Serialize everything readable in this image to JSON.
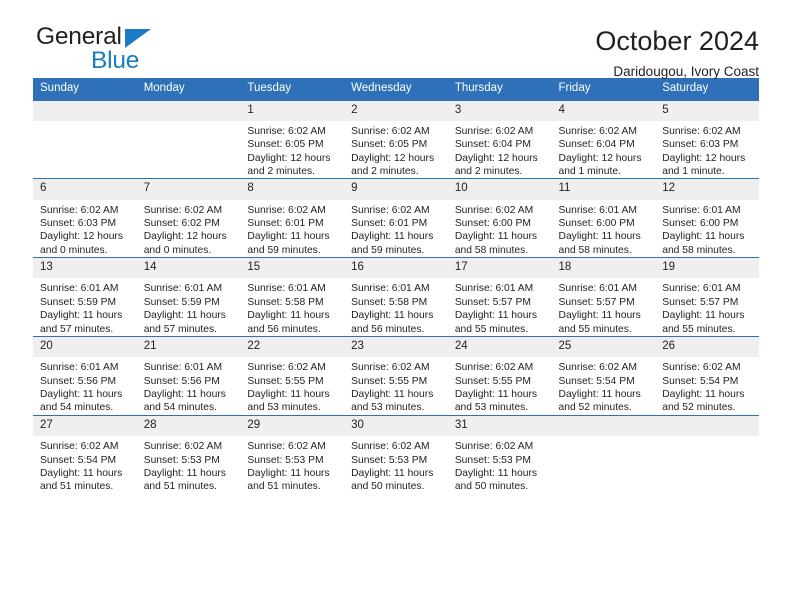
{
  "brand": {
    "name_top": "General",
    "name_bottom": "Blue",
    "triangle_color": "#1a7cc4",
    "text_color": "#231f20"
  },
  "header": {
    "month_title": "October 2024",
    "location": "Daridougou, Ivory Coast"
  },
  "theme": {
    "header_blue": "#2e71b8",
    "daynum_band": "#efefef",
    "text": "#231f20"
  },
  "weekdays": [
    "Sunday",
    "Monday",
    "Tuesday",
    "Wednesday",
    "Thursday",
    "Friday",
    "Saturday"
  ],
  "weeks": [
    [
      {
        "day": "",
        "blank": true
      },
      {
        "day": "",
        "blank": true
      },
      {
        "day": "1",
        "sunrise": "Sunrise: 6:02 AM",
        "sunset": "Sunset: 6:05 PM",
        "daylight": "Daylight: 12 hours and 2 minutes."
      },
      {
        "day": "2",
        "sunrise": "Sunrise: 6:02 AM",
        "sunset": "Sunset: 6:05 PM",
        "daylight": "Daylight: 12 hours and 2 minutes."
      },
      {
        "day": "3",
        "sunrise": "Sunrise: 6:02 AM",
        "sunset": "Sunset: 6:04 PM",
        "daylight": "Daylight: 12 hours and 2 minutes."
      },
      {
        "day": "4",
        "sunrise": "Sunrise: 6:02 AM",
        "sunset": "Sunset: 6:04 PM",
        "daylight": "Daylight: 12 hours and 1 minute."
      },
      {
        "day": "5",
        "sunrise": "Sunrise: 6:02 AM",
        "sunset": "Sunset: 6:03 PM",
        "daylight": "Daylight: 12 hours and 1 minute."
      }
    ],
    [
      {
        "day": "6",
        "sunrise": "Sunrise: 6:02 AM",
        "sunset": "Sunset: 6:03 PM",
        "daylight": "Daylight: 12 hours and 0 minutes."
      },
      {
        "day": "7",
        "sunrise": "Sunrise: 6:02 AM",
        "sunset": "Sunset: 6:02 PM",
        "daylight": "Daylight: 12 hours and 0 minutes."
      },
      {
        "day": "8",
        "sunrise": "Sunrise: 6:02 AM",
        "sunset": "Sunset: 6:01 PM",
        "daylight": "Daylight: 11 hours and 59 minutes."
      },
      {
        "day": "9",
        "sunrise": "Sunrise: 6:02 AM",
        "sunset": "Sunset: 6:01 PM",
        "daylight": "Daylight: 11 hours and 59 minutes."
      },
      {
        "day": "10",
        "sunrise": "Sunrise: 6:02 AM",
        "sunset": "Sunset: 6:00 PM",
        "daylight": "Daylight: 11 hours and 58 minutes."
      },
      {
        "day": "11",
        "sunrise": "Sunrise: 6:01 AM",
        "sunset": "Sunset: 6:00 PM",
        "daylight": "Daylight: 11 hours and 58 minutes."
      },
      {
        "day": "12",
        "sunrise": "Sunrise: 6:01 AM",
        "sunset": "Sunset: 6:00 PM",
        "daylight": "Daylight: 11 hours and 58 minutes."
      }
    ],
    [
      {
        "day": "13",
        "sunrise": "Sunrise: 6:01 AM",
        "sunset": "Sunset: 5:59 PM",
        "daylight": "Daylight: 11 hours and 57 minutes."
      },
      {
        "day": "14",
        "sunrise": "Sunrise: 6:01 AM",
        "sunset": "Sunset: 5:59 PM",
        "daylight": "Daylight: 11 hours and 57 minutes."
      },
      {
        "day": "15",
        "sunrise": "Sunrise: 6:01 AM",
        "sunset": "Sunset: 5:58 PM",
        "daylight": "Daylight: 11 hours and 56 minutes."
      },
      {
        "day": "16",
        "sunrise": "Sunrise: 6:01 AM",
        "sunset": "Sunset: 5:58 PM",
        "daylight": "Daylight: 11 hours and 56 minutes."
      },
      {
        "day": "17",
        "sunrise": "Sunrise: 6:01 AM",
        "sunset": "Sunset: 5:57 PM",
        "daylight": "Daylight: 11 hours and 55 minutes."
      },
      {
        "day": "18",
        "sunrise": "Sunrise: 6:01 AM",
        "sunset": "Sunset: 5:57 PM",
        "daylight": "Daylight: 11 hours and 55 minutes."
      },
      {
        "day": "19",
        "sunrise": "Sunrise: 6:01 AM",
        "sunset": "Sunset: 5:57 PM",
        "daylight": "Daylight: 11 hours and 55 minutes."
      }
    ],
    [
      {
        "day": "20",
        "sunrise": "Sunrise: 6:01 AM",
        "sunset": "Sunset: 5:56 PM",
        "daylight": "Daylight: 11 hours and 54 minutes."
      },
      {
        "day": "21",
        "sunrise": "Sunrise: 6:01 AM",
        "sunset": "Sunset: 5:56 PM",
        "daylight": "Daylight: 11 hours and 54 minutes."
      },
      {
        "day": "22",
        "sunrise": "Sunrise: 6:02 AM",
        "sunset": "Sunset: 5:55 PM",
        "daylight": "Daylight: 11 hours and 53 minutes."
      },
      {
        "day": "23",
        "sunrise": "Sunrise: 6:02 AM",
        "sunset": "Sunset: 5:55 PM",
        "daylight": "Daylight: 11 hours and 53 minutes."
      },
      {
        "day": "24",
        "sunrise": "Sunrise: 6:02 AM",
        "sunset": "Sunset: 5:55 PM",
        "daylight": "Daylight: 11 hours and 53 minutes."
      },
      {
        "day": "25",
        "sunrise": "Sunrise: 6:02 AM",
        "sunset": "Sunset: 5:54 PM",
        "daylight": "Daylight: 11 hours and 52 minutes."
      },
      {
        "day": "26",
        "sunrise": "Sunrise: 6:02 AM",
        "sunset": "Sunset: 5:54 PM",
        "daylight": "Daylight: 11 hours and 52 minutes."
      }
    ],
    [
      {
        "day": "27",
        "sunrise": "Sunrise: 6:02 AM",
        "sunset": "Sunset: 5:54 PM",
        "daylight": "Daylight: 11 hours and 51 minutes."
      },
      {
        "day": "28",
        "sunrise": "Sunrise: 6:02 AM",
        "sunset": "Sunset: 5:53 PM",
        "daylight": "Daylight: 11 hours and 51 minutes."
      },
      {
        "day": "29",
        "sunrise": "Sunrise: 6:02 AM",
        "sunset": "Sunset: 5:53 PM",
        "daylight": "Daylight: 11 hours and 51 minutes."
      },
      {
        "day": "30",
        "sunrise": "Sunrise: 6:02 AM",
        "sunset": "Sunset: 5:53 PM",
        "daylight": "Daylight: 11 hours and 50 minutes."
      },
      {
        "day": "31",
        "sunrise": "Sunrise: 6:02 AM",
        "sunset": "Sunset: 5:53 PM",
        "daylight": "Daylight: 11 hours and 50 minutes."
      },
      {
        "day": "",
        "blank": true
      },
      {
        "day": "",
        "blank": true
      }
    ]
  ]
}
